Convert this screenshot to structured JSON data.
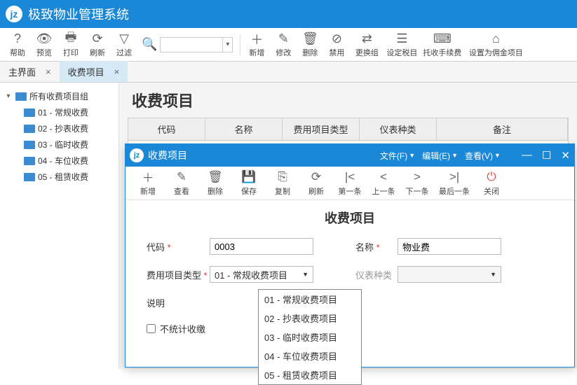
{
  "app": {
    "title": "极致物业管理系统"
  },
  "toolbar": {
    "help": "帮助",
    "preview": "预览",
    "print": "打印",
    "refresh": "刷新",
    "filter": "过滤",
    "add": "新增",
    "edit": "修改",
    "delete": "删除",
    "forbid": "禁用",
    "changeGroup": "更换组",
    "setTax": "设定税目",
    "agentFee": "托收手续费",
    "commission": "设置为佣金项目",
    "searchPlaceholder": ""
  },
  "tabs": {
    "main": "主界面",
    "charge": "收费项目"
  },
  "tree": {
    "root": "所有收费项目组",
    "items": [
      "01 - 常规收费",
      "02 - 抄表收费",
      "03 - 临时收费",
      "04 - 车位收费",
      "05 - 租赁收费"
    ]
  },
  "content": {
    "heading": "收费项目"
  },
  "grid": {
    "code": "代码",
    "name": "名称",
    "type": "费用项目类型",
    "meter": "仪表种类",
    "remark": "备注"
  },
  "dialog": {
    "title": "收费项目",
    "menus": {
      "file": "文件(F)",
      "edit": "编辑(E)",
      "view": "查看(V)"
    },
    "tb": {
      "add": "新增",
      "view": "查看",
      "delete": "删除",
      "save": "保存",
      "copy": "复制",
      "refresh": "刷新",
      "first": "第一条",
      "prev": "上一条",
      "next": "下一条",
      "last": "最后一条",
      "close": "关闭"
    },
    "heading": "收费项目",
    "form": {
      "codeLabel": "代码",
      "codeValue": "0003",
      "nameLabel": "名称",
      "nameValue": "物业费",
      "typeLabel": "费用项目类型",
      "typeValue": "01 - 常规收费项目",
      "meterLabel": "仪表种类",
      "meterValue": "",
      "descLabel": "说明",
      "descValue": "",
      "noStatsLabel": "不统计收缴"
    },
    "options": [
      "01 - 常规收费项目",
      "02 - 抄表收费项目",
      "03 - 临时收费项目",
      "04 - 车位收费项目",
      "05 - 租赁收费项目"
    ]
  }
}
